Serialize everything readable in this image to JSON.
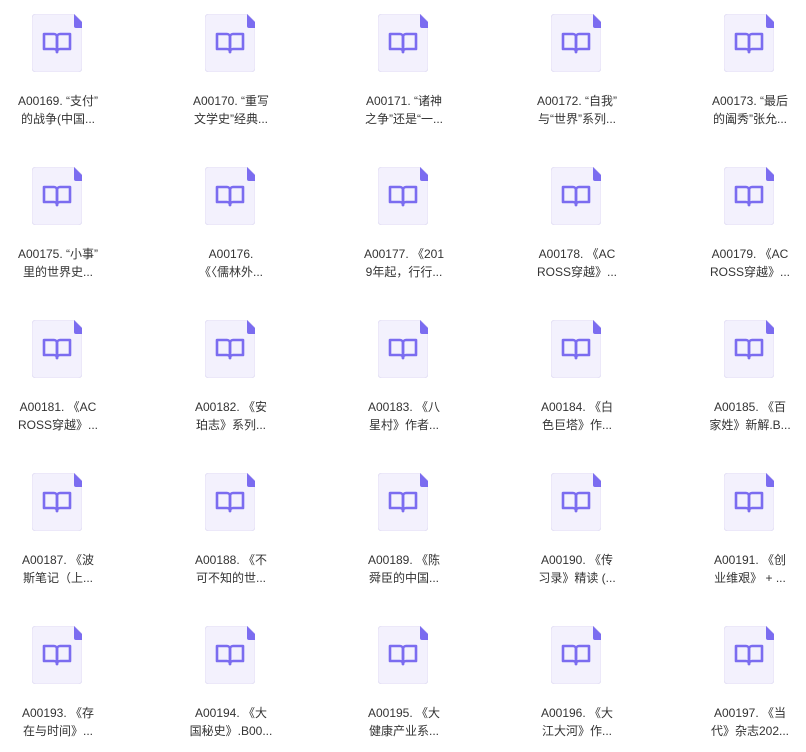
{
  "file_icon": "book-file-icon",
  "colors": {
    "icon_page": "#f3f1fd",
    "icon_border": "#e4e0f5",
    "icon_fold": "#7b6cf0",
    "icon_book": "#7b6cf0",
    "label_text": "#333333"
  },
  "files": [
    {
      "line1": "A00169. “支付”",
      "line2": "的战争(中国..."
    },
    {
      "line1": "A00170. “重写",
      "line2": "文学史”经典..."
    },
    {
      "line1": "A00171. “诸神",
      "line2": "之争”还是“一..."
    },
    {
      "line1": "A00172. “自我”",
      "line2": "与“世界”系列..."
    },
    {
      "line1": "A00173. “最后",
      "line2": "的阖秀”张允..."
    },
    {
      "line1": "A00175. “小事”",
      "line2": "里的世界史..."
    },
    {
      "line1": "A00176.",
      "line2": "《〈儒林外..."
    },
    {
      "line1": "A00177. 《201",
      "line2": "9年起，行行..."
    },
    {
      "line1": "A00178. 《AC",
      "line2": "ROSS穿越》..."
    },
    {
      "line1": "A00179. 《AC",
      "line2": "ROSS穿越》..."
    },
    {
      "line1": "A00181. 《AC",
      "line2": "ROSS穿越》..."
    },
    {
      "line1": "A00182. 《安",
      "line2": "珀志》系列..."
    },
    {
      "line1": "A00183. 《八",
      "line2": "星村》作者..."
    },
    {
      "line1": "A00184. 《白",
      "line2": "色巨塔》作..."
    },
    {
      "line1": "A00185. 《百",
      "line2": "家姓》新解.B..."
    },
    {
      "line1": "A00187. 《波",
      "line2": "斯笔记（上..."
    },
    {
      "line1": "A00188. 《不",
      "line2": "可不知的世..."
    },
    {
      "line1": "A00189. 《陈",
      "line2": "舜臣的中国..."
    },
    {
      "line1": "A00190. 《传",
      "line2": "习录》精读 (..."
    },
    {
      "line1": "A00191. 《创",
      "line2": "业维艰》 + ..."
    },
    {
      "line1": "A00193. 《存",
      "line2": "在与时间》..."
    },
    {
      "line1": "A00194. 《大",
      "line2": "国秘史》.B00..."
    },
    {
      "line1": "A00195. 《大",
      "line2": "健康产业系..."
    },
    {
      "line1": "A00196. 《大",
      "line2": "江大河》作..."
    },
    {
      "line1": "A00197. 《当",
      "line2": "代》杂志202..."
    }
  ]
}
